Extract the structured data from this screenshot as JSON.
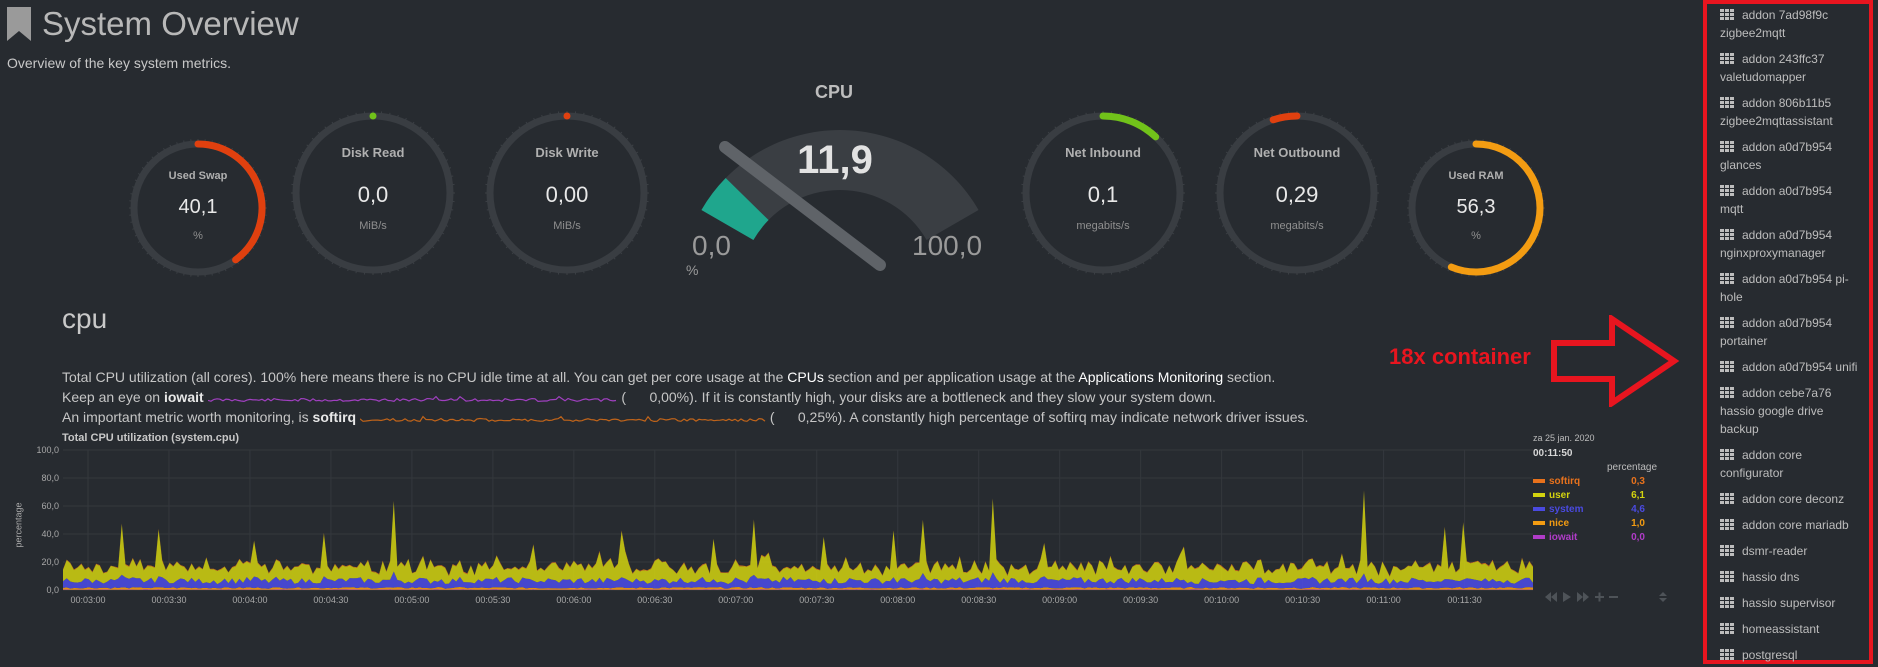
{
  "header": {
    "title": "System Overview",
    "subtitle": "Overview of the key system metrics."
  },
  "gauges": {
    "swap": {
      "title": "Used Swap",
      "value": "40,1",
      "unit": "%",
      "fill_fraction": 0.4,
      "color": "#e0400f"
    },
    "disk_read": {
      "title": "Disk Read",
      "value": "0,0",
      "unit": "MiB/s",
      "fill_fraction": 0.0,
      "color": "#71c21a"
    },
    "disk_write": {
      "title": "Disk Write",
      "value": "0,00",
      "unit": "MiB/s",
      "fill_fraction": 0.0,
      "color": "#e0400f"
    },
    "net_in": {
      "title": "Net Inbound",
      "value": "0,1",
      "unit": "megabits/s",
      "fill_fraction": 0.12,
      "color": "#71c21a"
    },
    "net_out": {
      "title": "Net Outbound",
      "value": "0,29",
      "unit": "megabits/s",
      "fill_fraction": 0.05,
      "color": "#e0400f"
    },
    "ram": {
      "title": "Used RAM",
      "value": "56,3",
      "unit": "%",
      "fill_fraction": 0.563,
      "color": "#f39c12"
    }
  },
  "cpu_gauge": {
    "title": "CPU",
    "value": "11,9",
    "min": "0,0",
    "max": "100,0",
    "unit": "%",
    "fill_fraction": 0.119,
    "color": "#1fa68d"
  },
  "section": {
    "title": "cpu",
    "line1_a": "Total CPU utilization (all cores). 100% here means there is no CPU idle time at all. You can get per core usage at the ",
    "line1_link1": "CPUs",
    "line1_b": " section and per application usage at the ",
    "line1_link2": "Applications Monitoring",
    "line1_c": " section.",
    "line2_a": "Keep an eye on ",
    "line2_bold": "iowait",
    "line2_value": "0,00%",
    "line2_b": "). If it is constantly high, your disks are a bottleneck and they slow your system down.",
    "line3_a": "An important metric worth monitoring, is ",
    "line3_bold": "softirq",
    "line3_value": "0,25%",
    "line3_b": "). A constantly high percentage of softirq may indicate network driver issues."
  },
  "chart_data": {
    "type": "area",
    "title": "Total CPU utilization (system.cpu)",
    "ylabel": "percentage",
    "ylim": [
      0,
      100
    ],
    "yticks": [
      "100,0",
      "80,0",
      "60,0",
      "40,0",
      "20,0",
      "0,0"
    ],
    "xticks": [
      "00:03:00",
      "00:03:30",
      "00:04:00",
      "00:04:30",
      "00:05:00",
      "00:05:30",
      "00:06:00",
      "00:06:30",
      "00:07:00",
      "00:07:30",
      "00:08:00",
      "00:08:30",
      "00:09:00",
      "00:09:30",
      "00:10:00",
      "00:10:30",
      "00:11:00",
      "00:11:30"
    ],
    "date": "za 25 jan. 2020",
    "time": "00:11:50",
    "legend_header": "percentage",
    "series": [
      {
        "name": "softirq",
        "value": "0,3",
        "color": "#e8721c",
        "approx_level": 0.3
      },
      {
        "name": "user",
        "value": "6,1",
        "color": "#d4d40f",
        "approx_level": 6.1
      },
      {
        "name": "system",
        "value": "4,6",
        "color": "#4a4ae0",
        "approx_level": 4.6
      },
      {
        "name": "nice",
        "value": "1,0",
        "color": "#f39c12",
        "approx_level": 1.0
      },
      {
        "name": "iowait",
        "value": "0,0",
        "color": "#b03cc8",
        "approx_level": 0.0
      }
    ]
  },
  "sidebar": {
    "items": [
      {
        "line1": "addon 7ad98f9c",
        "line2": "zigbee2mqtt"
      },
      {
        "line1": "addon 243ffc37",
        "line2": "valetudomapper"
      },
      {
        "line1": "addon 806b11b5",
        "line2": "zigbee2mqttassistant"
      },
      {
        "line1": "addon a0d7b954",
        "line2": "glances"
      },
      {
        "line1": "addon a0d7b954",
        "line2": "mqtt"
      },
      {
        "line1": "addon a0d7b954",
        "line2": "nginxproxymanager"
      },
      {
        "line1": "addon a0d7b954 pi-",
        "line2": "hole"
      },
      {
        "line1": "addon a0d7b954",
        "line2": "portainer"
      },
      {
        "line1": "addon a0d7b954 unifi",
        "line2": ""
      },
      {
        "line1": "addon cebe7a76",
        "line2": "hassio google drive",
        "line3": "backup"
      },
      {
        "line1": "addon core",
        "line2": "configurator"
      },
      {
        "line1": "addon core deconz",
        "line2": ""
      },
      {
        "line1": "addon core mariadb",
        "line2": ""
      },
      {
        "line1": "dsmr-reader",
        "line2": ""
      },
      {
        "line1": "hassio dns",
        "line2": ""
      },
      {
        "line1": "hassio supervisor",
        "line2": ""
      },
      {
        "line1": "homeassistant",
        "line2": ""
      },
      {
        "line1": "postgresql",
        "line2": ""
      }
    ]
  },
  "annotation": {
    "text": "18x container",
    "color": "#e8151f"
  }
}
